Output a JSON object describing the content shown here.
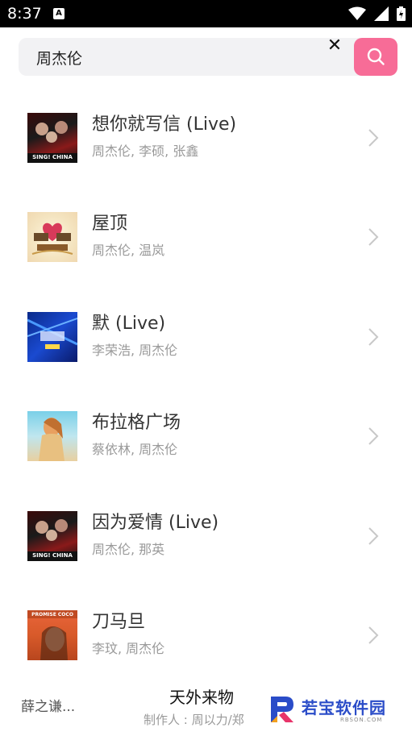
{
  "status_bar": {
    "time": "8:37",
    "notification_icon": "A",
    "icons": [
      "wifi-icon",
      "signal-icon",
      "battery-icon"
    ]
  },
  "search": {
    "value": "周杰伦",
    "clear_label": "✕",
    "button_icon": "search-icon",
    "button_color": "#f76c97"
  },
  "songs": [
    {
      "title": "想你就写信 (Live)",
      "artists": "周杰伦, 李硕, 张鑫",
      "cover_label": "SING! CHINA"
    },
    {
      "title": "屋顶",
      "artists": "周杰伦, 温岚",
      "cover_label": ""
    },
    {
      "title": "默 (Live)",
      "artists": "李荣浩, 周杰伦",
      "cover_label": ""
    },
    {
      "title": "布拉格广场",
      "artists": "蔡依林, 周杰伦",
      "cover_label": ""
    },
    {
      "title": "因为爱情 (Live)",
      "artists": "周杰伦, 那英",
      "cover_label": "SING! CHINA"
    },
    {
      "title": "刀马旦",
      "artists": "李玟, 周杰伦",
      "cover_label": "PROMISE COCO"
    }
  ],
  "player": {
    "left_text": "薛之谦...",
    "title": "天外来物",
    "producer": "制作人 : 周以力/郑"
  },
  "watermark": {
    "text": "若宝软件园",
    "sub": "RBSON.COM"
  }
}
